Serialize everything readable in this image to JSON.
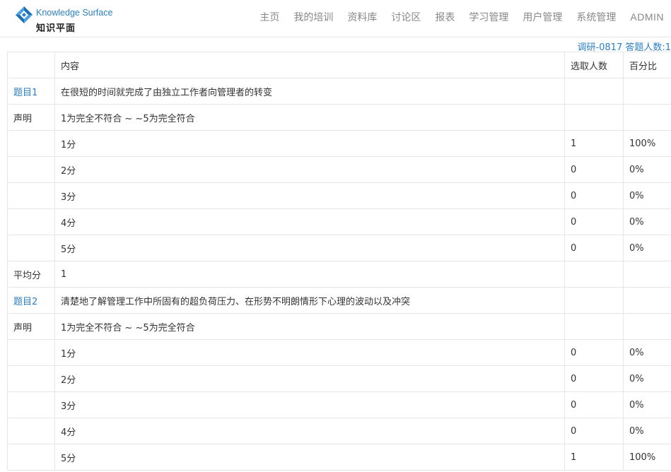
{
  "brand": {
    "name_en": "Knowledge Surface",
    "name_cn": "知识平面",
    "colors": {
      "accent": "#2b7fc3",
      "diamond_dark": "#1d6fb3",
      "diamond_light": "#4aa3e0"
    }
  },
  "nav": {
    "items": [
      {
        "id": "home",
        "label": "主页"
      },
      {
        "id": "my-training",
        "label": "我的培训"
      },
      {
        "id": "library",
        "label": "资料库"
      },
      {
        "id": "discussion",
        "label": "讨论区"
      },
      {
        "id": "reports",
        "label": "报表"
      },
      {
        "id": "learning-mgmt",
        "label": "学习管理"
      },
      {
        "id": "user-mgmt",
        "label": "用户管理"
      },
      {
        "id": "system-mgmt",
        "label": "系统管理"
      },
      {
        "id": "admin",
        "label": "ADMIN"
      }
    ]
  },
  "survey": {
    "title": "调研-0817 答题人数:1"
  },
  "table": {
    "headers": {
      "label": "",
      "content": "内容",
      "count": "选取人数",
      "percent": "百分比"
    },
    "rows": [
      {
        "type": "question",
        "label": "题目1",
        "content": "在很短的时间就完成了由独立工作者向管理者的转变",
        "count": "",
        "percent": ""
      },
      {
        "type": "statement",
        "label": "声明",
        "content": "1为完全不符合 ~ ~5为完全符合",
        "count": "",
        "percent": ""
      },
      {
        "type": "option",
        "label": "",
        "content": "1分",
        "count": "1",
        "percent": "100%"
      },
      {
        "type": "option",
        "label": "",
        "content": "2分",
        "count": "0",
        "percent": "0%"
      },
      {
        "type": "option",
        "label": "",
        "content": "3分",
        "count": "0",
        "percent": "0%"
      },
      {
        "type": "option",
        "label": "",
        "content": "4分",
        "count": "0",
        "percent": "0%"
      },
      {
        "type": "option",
        "label": "",
        "content": "5分",
        "count": "0",
        "percent": "0%"
      },
      {
        "type": "average",
        "label": "平均分",
        "content": "1",
        "count": "",
        "percent": ""
      },
      {
        "type": "question",
        "label": "题目2",
        "content": "清楚地了解管理工作中所固有的超负荷压力、在形势不明朗情形下心理的波动以及冲突",
        "count": "",
        "percent": ""
      },
      {
        "type": "statement",
        "label": "声明",
        "content": "1为完全不符合 ~ ~5为完全符合",
        "count": "",
        "percent": ""
      },
      {
        "type": "option",
        "label": "",
        "content": "1分",
        "count": "0",
        "percent": "0%"
      },
      {
        "type": "option",
        "label": "",
        "content": "2分",
        "count": "0",
        "percent": "0%"
      },
      {
        "type": "option",
        "label": "",
        "content": "3分",
        "count": "0",
        "percent": "0%"
      },
      {
        "type": "option",
        "label": "",
        "content": "4分",
        "count": "0",
        "percent": "0%"
      },
      {
        "type": "option",
        "label": "",
        "content": "5分",
        "count": "1",
        "percent": "100%"
      }
    ]
  }
}
